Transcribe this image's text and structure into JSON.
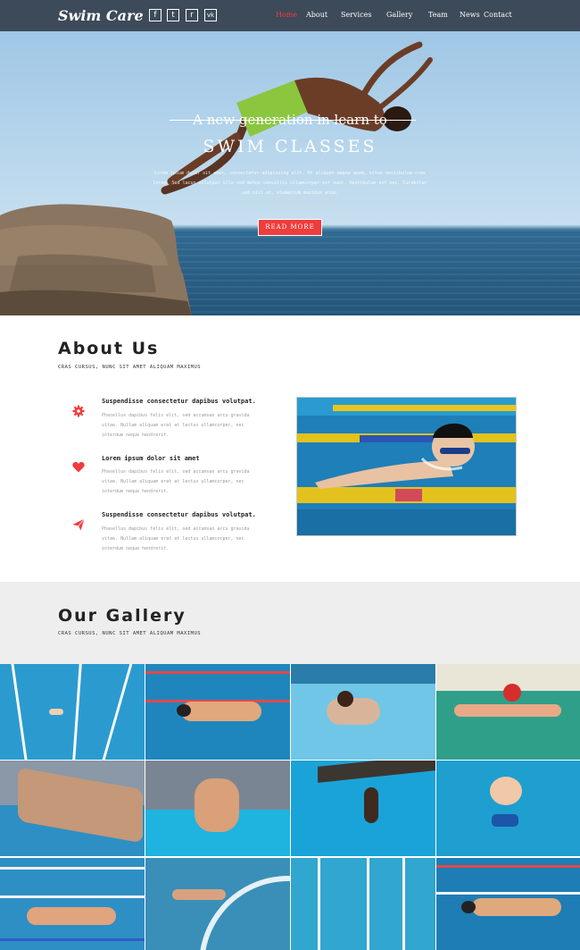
{
  "brand": "Swim Care",
  "social": [
    {
      "icon": "facebook-icon",
      "glyph": "f"
    },
    {
      "icon": "twitter-icon",
      "glyph": "t"
    },
    {
      "icon": "rss-icon",
      "glyph": "r"
    },
    {
      "icon": "vk-icon",
      "glyph": "vk"
    }
  ],
  "menu": [
    "Home",
    "About",
    "Services",
    "Gallery",
    "Team",
    "News",
    "Contact"
  ],
  "active_menu": "Home",
  "hero": {
    "subtitle": "A new generation in learn to",
    "title": "SWIM CLASSES",
    "paragraph": "Lorem ipsum dolor sit amet, consectetur adipiscing elit. Ut aliquet magna quam, vitae vestibulum cras lorem. Sed lacus volutpat ulla sed metus convallis ullamcorper est nunc. Vestibulum est nec. Curabitur sed nisl at, elementum maximus enim.",
    "button": "READ MORE"
  },
  "about": {
    "title": "About Us",
    "subtitle": "CRAS CURSUS, NUNC SIT AMET ALIQUAM MAXIMUS",
    "features": [
      {
        "icon": "gear-icon",
        "title": "Suspendisse consectetur dapibus volutpat.",
        "text": "Phasellus dapibus felis elit, sed accumsan arcu gravida vitae. Nullam aliquam erat at lectus ullamcorper, nec interdum neque hendrerit."
      },
      {
        "icon": "heart-icon",
        "title": "Lorem ipsum dolor sit amet",
        "text": "Phasellus dapibus felis elit, sed accumsan arcu gravida vitae. Nullam aliquam erat at lectus ullamcorper, nec interdum neque hendrerit."
      },
      {
        "icon": "paper-plane-icon",
        "title": "Suspendisse consectetur dapibus volutpat.",
        "text": "Phasellus dapibus felis elit, sed accumsan arcu gravida vitae. Nullam aliquam erat at lectus ullamcorper, nec interdum neque hendrerit."
      }
    ]
  },
  "gallery": {
    "title": "Our Gallery",
    "subtitle": "CRAS CURSUS, NUNC SIT AMET ALIQUAM MAXIMUS"
  },
  "colors": {
    "nav": "#3d4a5a",
    "accent": "#ef3c3c",
    "gallery_bg": "#eeeeee"
  }
}
